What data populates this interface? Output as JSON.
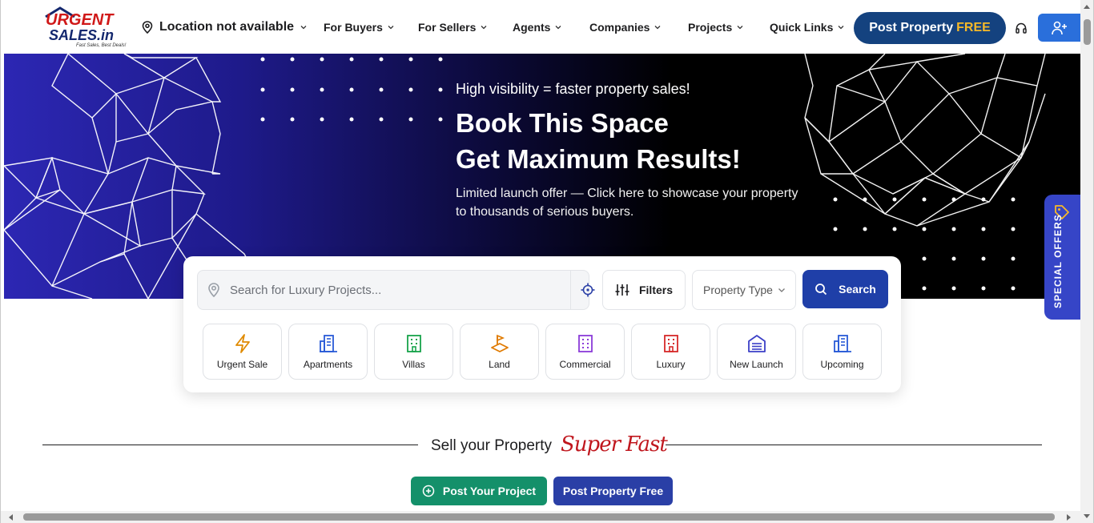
{
  "brand": {
    "logo_line1": "URGENT",
    "logo_line2": "SALES.in",
    "tagline": "Fast Sales, Best Deals!"
  },
  "header": {
    "location": "Location not available",
    "nav": [
      "For Buyers",
      "For Sellers",
      "Agents",
      "Companies",
      "Projects",
      "Quick Links"
    ],
    "post_label": "Post Property",
    "post_free": "FREE"
  },
  "banner": {
    "subtitle": "High visibility = faster property sales!",
    "title_line1": "Book This Space",
    "title_line2": "Get Maximum Results!",
    "description": "Limited launch offer — Click here to showcase your property to thousands of serious buyers."
  },
  "special_offers": "SPECIAL OFFERS",
  "search": {
    "placeholder": "Search for Luxury Projects...",
    "filters_label": "Filters",
    "property_type": "Property Type",
    "search_label": "Search"
  },
  "categories": [
    {
      "label": "Urgent Sale",
      "icon": "lightning-icon",
      "color": "#e08a00"
    },
    {
      "label": "Apartments",
      "icon": "apartment-icon",
      "color": "#2a5bd7"
    },
    {
      "label": "Villas",
      "icon": "villa-icon",
      "color": "#17a34a"
    },
    {
      "label": "Land",
      "icon": "land-icon",
      "color": "#e07a00"
    },
    {
      "label": "Commercial",
      "icon": "commercial-icon",
      "color": "#8b3bd8"
    },
    {
      "label": "Luxury",
      "icon": "luxury-icon",
      "color": "#d62828"
    },
    {
      "label": "New Launch",
      "icon": "new-launch-icon",
      "color": "#3b3fc7"
    },
    {
      "label": "Upcoming",
      "icon": "upcoming-icon",
      "color": "#2a5bd7"
    }
  ],
  "sell": {
    "text": "Sell your Property",
    "highlight": "Super Fast",
    "post_project": "Post Your Project",
    "post_property_free": "Post Property Free"
  },
  "colors": {
    "primary": "#14427f",
    "accent": "#f7b928",
    "green": "#14906a",
    "blue": "#2a3fa6",
    "red": "#c0171e"
  }
}
